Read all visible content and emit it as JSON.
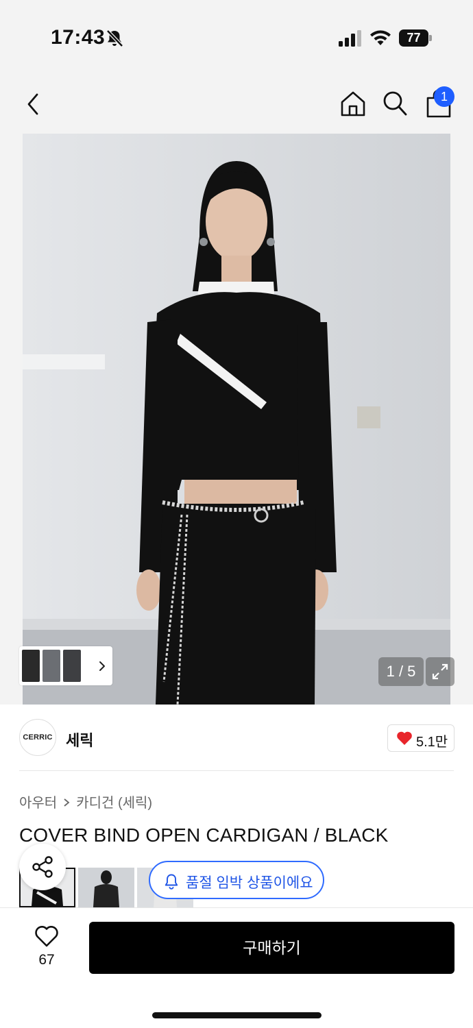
{
  "status_bar": {
    "time": "17:43",
    "battery": "77"
  },
  "nav": {
    "cart_count": "1"
  },
  "gallery": {
    "counter": "1 / 5"
  },
  "brand": {
    "logo_text": "CERRIC",
    "name": "세릭",
    "likes": "5.1만",
    "like_color": "#e8252b"
  },
  "product": {
    "breadcrumb": [
      "아우터",
      "카디건 (세릭)"
    ],
    "title": "COVER BIND OPEN CARDIGAN / BLACK"
  },
  "stock_alert": {
    "label": "품절 임박 상품이에요",
    "color": "#2f6bff"
  },
  "bottom_bar": {
    "wish_count": "67",
    "buy_label": "구매하기"
  },
  "icons": [
    "bell-off-icon",
    "signal-icon",
    "wifi-icon",
    "battery-icon",
    "back-arrow-icon",
    "home-icon",
    "search-icon",
    "shopping-bag-icon",
    "expand-icon",
    "heart-icon",
    "share-icon",
    "bell-icon",
    "chevron-right-icon"
  ]
}
